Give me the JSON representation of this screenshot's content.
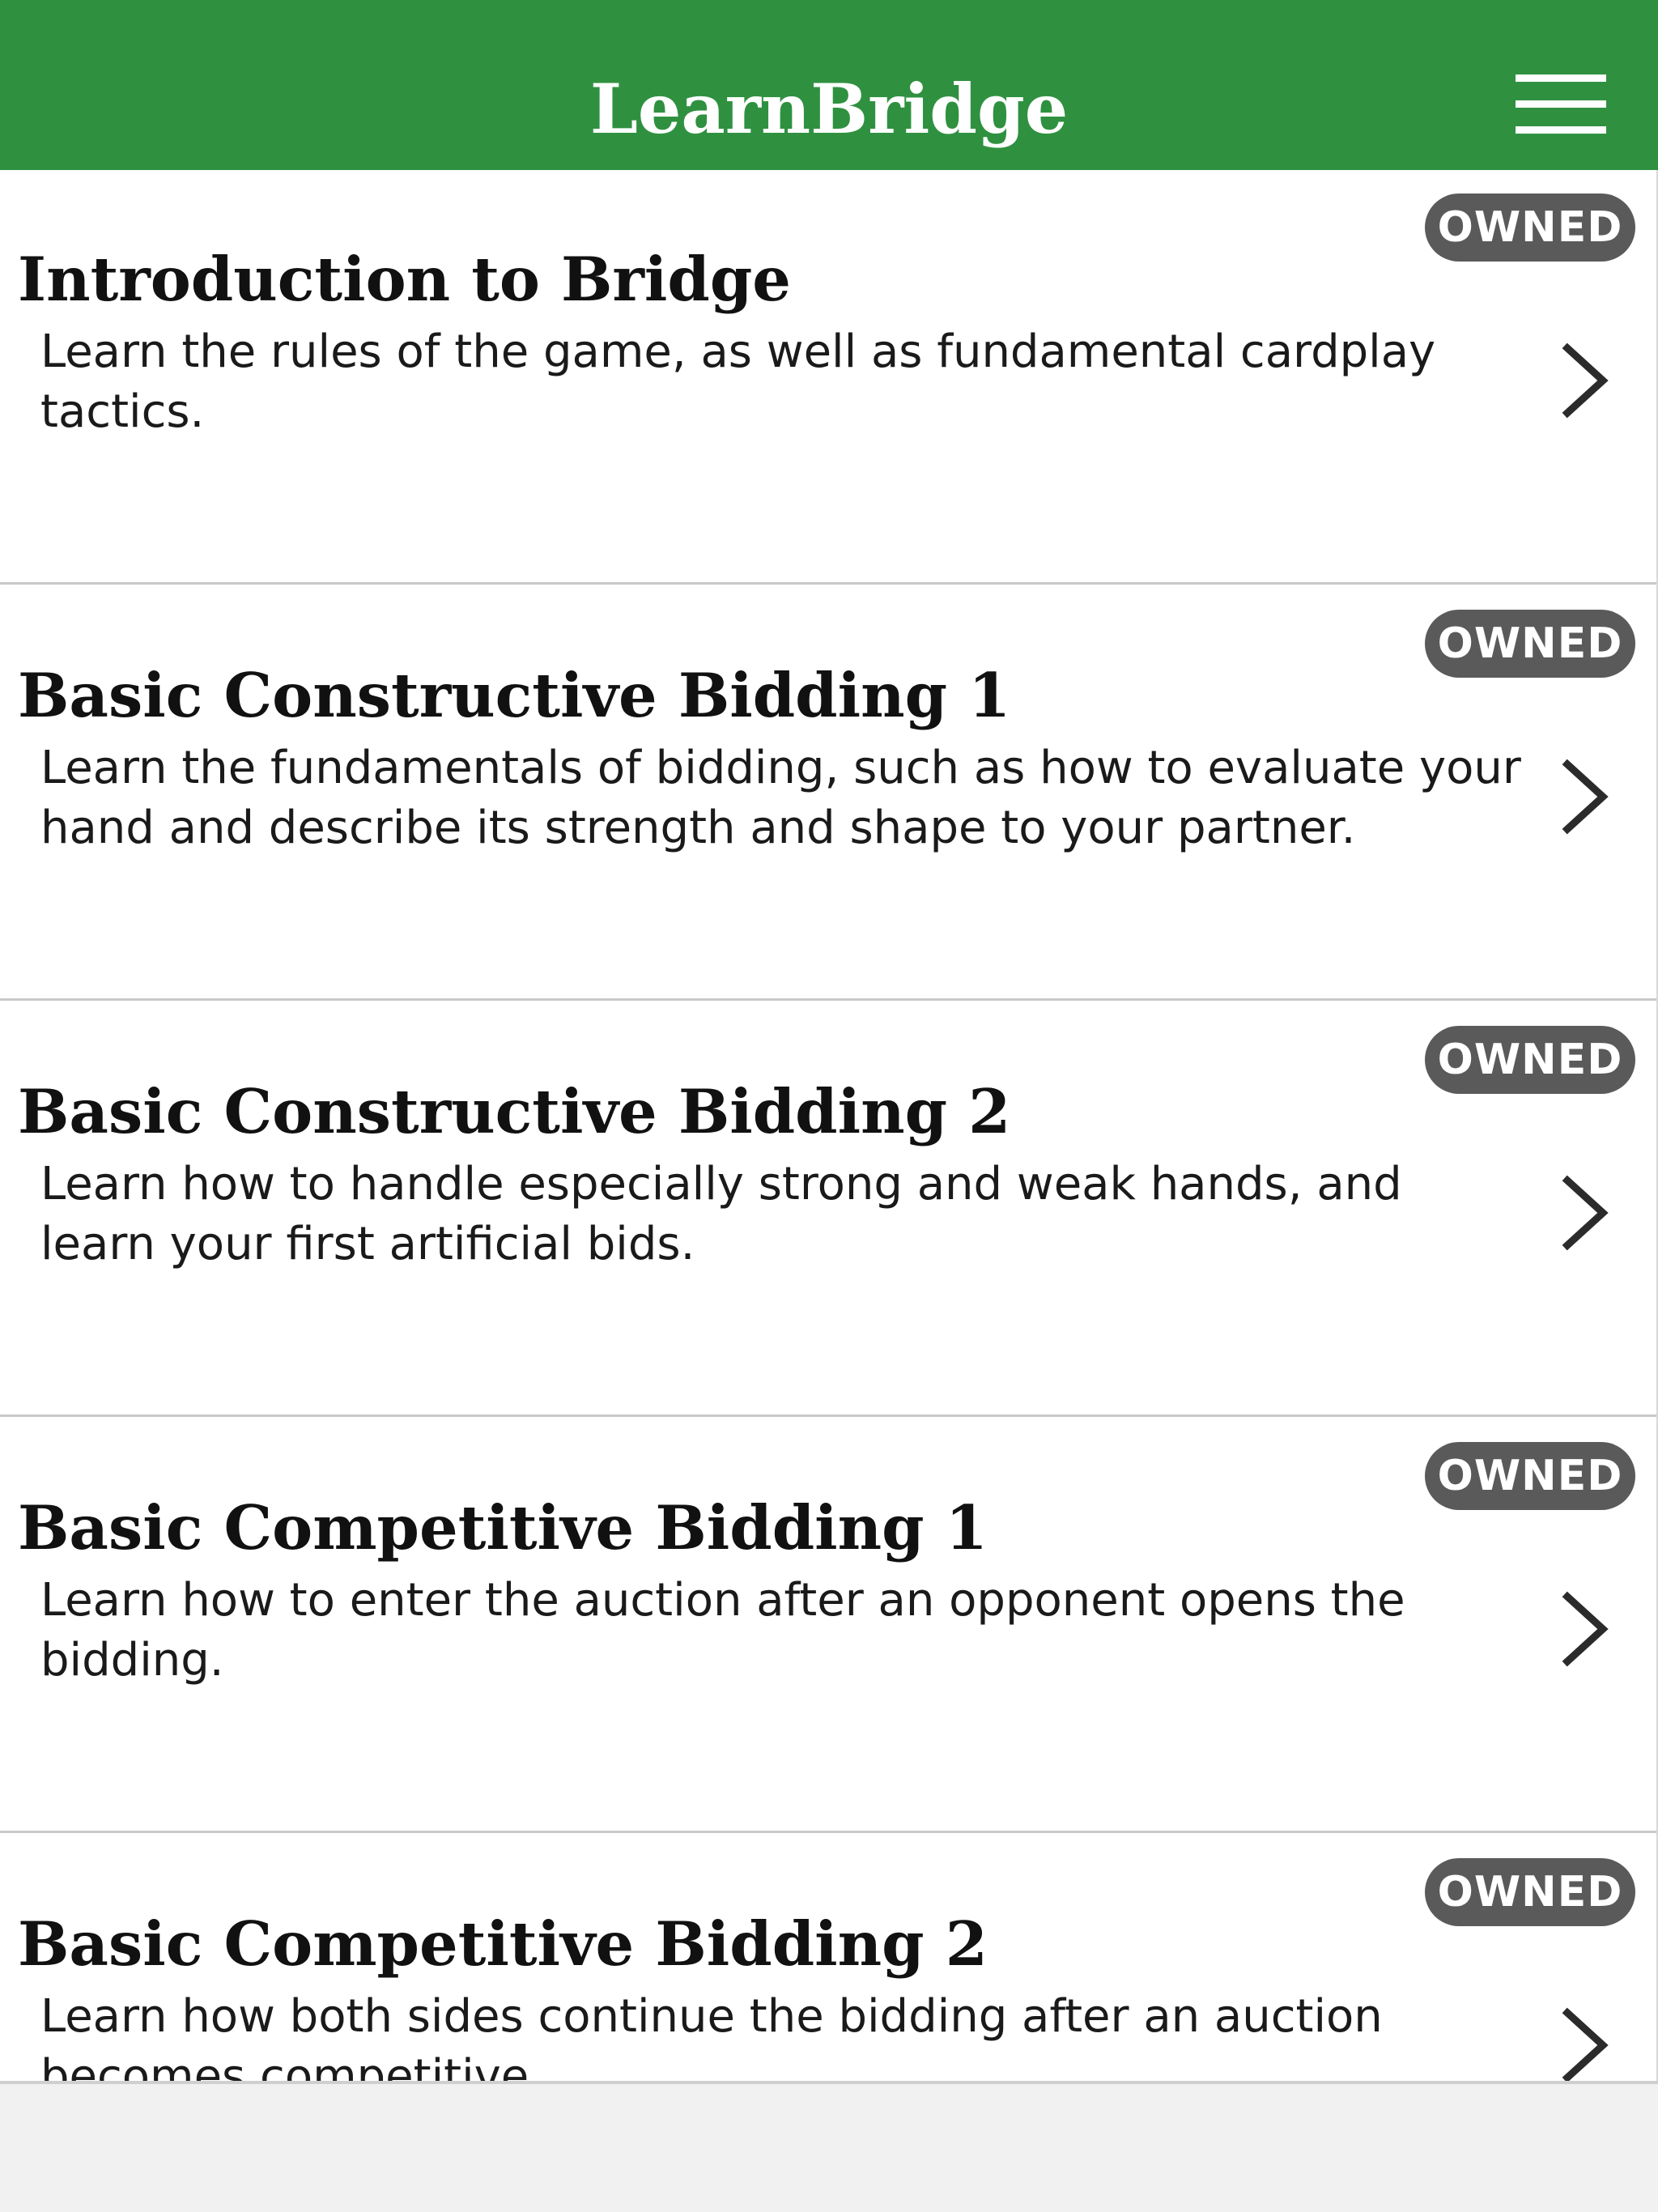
{
  "header": {
    "title": "LearnBridge",
    "menu_icon": "hamburger-menu-icon"
  },
  "courses": [
    {
      "badge": "OWNED",
      "title": "Introduction to Bridge",
      "description": "Learn the rules of the game, as well as fundamental cardplay tactics."
    },
    {
      "badge": "OWNED",
      "title": "Basic Constructive Bidding 1",
      "description": "Learn the fundamentals of bidding, such as how to evaluate your hand and describe its strength and shape to your partner."
    },
    {
      "badge": "OWNED",
      "title": "Basic Constructive Bidding 2",
      "description": "Learn how to handle especially strong and weak hands, and learn your first artificial bids."
    },
    {
      "badge": "OWNED",
      "title": "Basic Competitive Bidding 1",
      "description": "Learn how to enter the auction after an opponent opens the bidding."
    },
    {
      "badge": "OWNED",
      "title": "Basic Competitive Bidding 2",
      "description": "Learn how both sides continue the bidding after an auction becomes competitive."
    }
  ],
  "colors": {
    "header_bg": "#2f9140",
    "badge_bg": "#5a5a5a",
    "divider": "#c9c9c9",
    "bottom_bar_bg": "#f1f1f1"
  }
}
